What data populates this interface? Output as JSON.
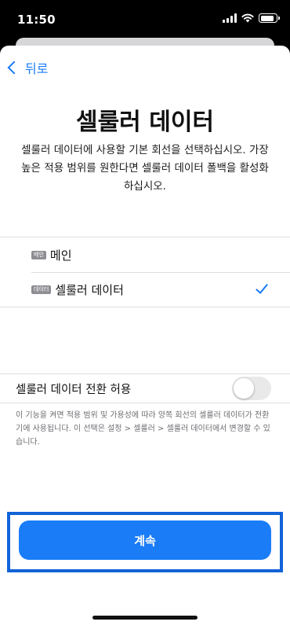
{
  "status_bar": {
    "time": "11:50",
    "icons": [
      "signal-icon",
      "wifi-icon",
      "battery-icon"
    ]
  },
  "nav": {
    "back_label": "뒤로"
  },
  "page": {
    "title": "셀룰러 데이터",
    "description": "셀룰러 데이터에 사용할 기본 회선을 선택하십시오. 가장 높은 적용 범위를 원한다면 셀룰러 데이터 폴백을 활성화하십시오."
  },
  "options": [
    {
      "badge": "메인",
      "label": "메인",
      "selected": false
    },
    {
      "badge": "데이터",
      "label": "셀룰러 데이터",
      "selected": true
    }
  ],
  "toggle": {
    "label": "셀룰러 데이터 전환 허용",
    "on": false
  },
  "footnote": "이 기능을 켜면 적용 범위 및 가용성에 따라 양쪽 회선의 셀룰러 데이터가 전환기에 사용됩니다. 이 선택은 설정 > 셀룰러 > 셀룰러 데이터에서 변경할 수 있습니다.",
  "continue_label": "계속",
  "colors": {
    "accent": "#1a7cf7",
    "highlight_frame": "#1264d8",
    "toggle_off": "#e9e9ea"
  }
}
